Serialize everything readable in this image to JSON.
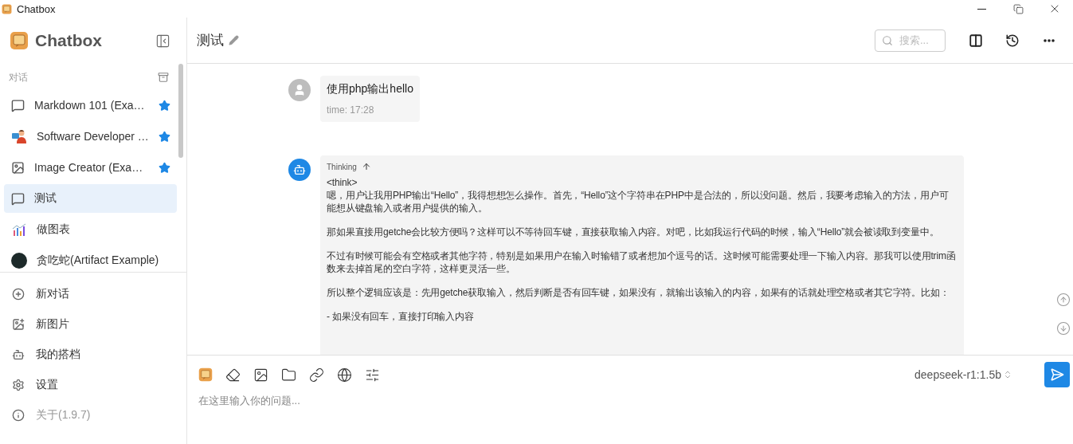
{
  "window": {
    "title": "Chatbox"
  },
  "sidebar": {
    "brand": "Chatbox",
    "section_label": "对话",
    "conversations": [
      {
        "title": "Markdown 101 (Exa…",
        "kind": "chat",
        "starred": true,
        "selected": false
      },
      {
        "title": "Software Developer …",
        "kind": "developer",
        "starred": true,
        "selected": false
      },
      {
        "title": "Image Creator (Exa…",
        "kind": "image",
        "starred": true,
        "selected": false
      },
      {
        "title": "测试",
        "kind": "chat",
        "starred": false,
        "selected": true
      },
      {
        "title": "做图表",
        "kind": "chart",
        "starred": false,
        "selected": false
      },
      {
        "title": "贪吃蛇(Artifact Example)",
        "kind": "dark",
        "starred": false,
        "selected": false
      }
    ],
    "menu": [
      {
        "label": "新对话",
        "kind": "new-chat"
      },
      {
        "label": "新图片",
        "kind": "new-image"
      },
      {
        "label": "我的搭档",
        "kind": "copilots"
      },
      {
        "label": "设置",
        "kind": "settings"
      },
      {
        "label": "关于(1.9.7)",
        "kind": "about"
      }
    ]
  },
  "header": {
    "title": "测试",
    "search": {
      "placeholder": "搜索..."
    }
  },
  "messages": [
    {
      "kind": "user",
      "text": "使用php输出hello",
      "time": "time: 17:28"
    },
    {
      "kind": "assistant",
      "thinking_label": "Thinking",
      "paragraphs": [
        "<think>\n嗯，用户让我用PHP输出“Hello”，我得想想怎么操作。首先，“Hello”这个字符串在PHP中是合法的，所以没问题。然后，我要考虑输入的方法，用户可能想从键盘输入或者用户提供的输入。",
        "那如果直接用getche会比较方便吗？这样可以不等待回车键，直接获取输入内容。对吧，比如我运行代码的时候，输入“Hello”就会被读取到变量中。",
        "不过有时候可能会有空格或者其他字符，特别是如果用户在输入时输错了或者想加个逗号的话。这时候可能需要处理一下输入内容。那我可以使用trim函数来去掉首尾的空白字符，这样更灵活一些。",
        "所以整个逻辑应该是：先用getche获取输入，然后判断是否有回车键，如果没有，就输出该输入的内容，如果有的话就处理空格或者其它字符。比如：",
        "- 如果没有回车，直接打印输入内容"
      ]
    }
  ],
  "composer": {
    "model": "deepseek-r1:1.5b",
    "placeholder": "在这里输入你的问题..."
  }
}
